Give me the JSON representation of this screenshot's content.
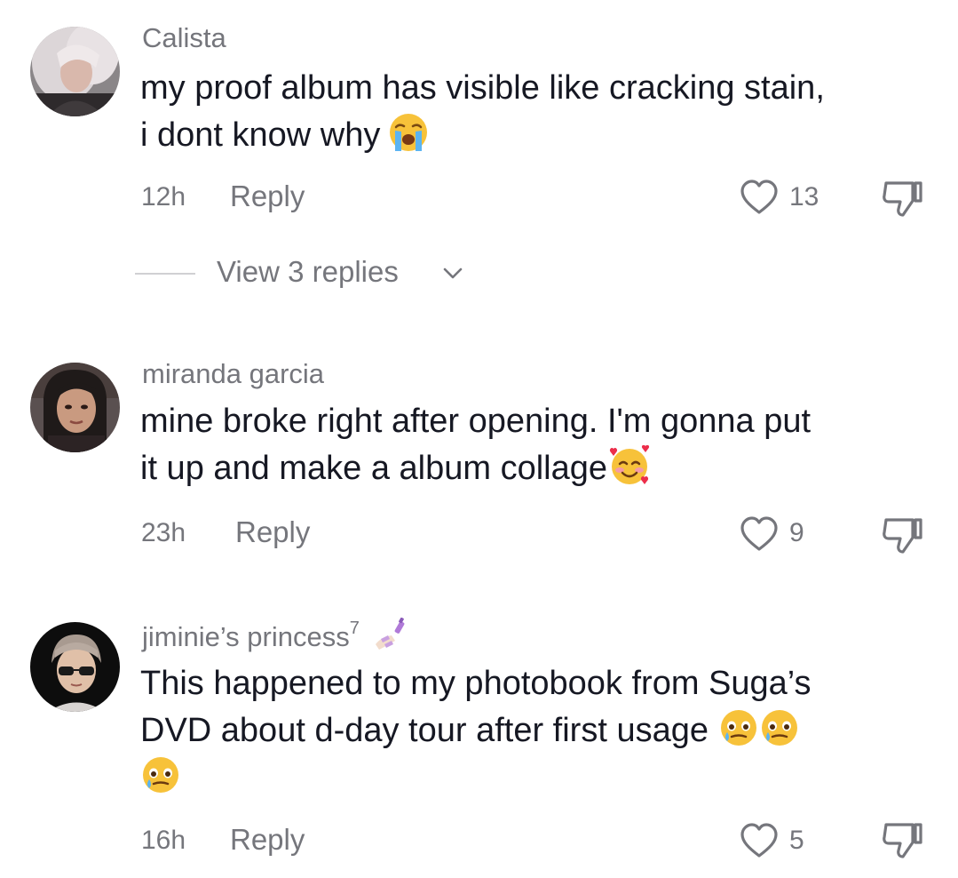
{
  "comments": [
    {
      "username": "Calista",
      "text_line1": "my proof album has visible like cracking stain,",
      "text_line2": "i dont know why ",
      "time": "12h",
      "reply_label": "Reply",
      "likes": "13",
      "emojis": [
        "loudly-crying-face-emoji"
      ],
      "view_replies": "View 3 replies"
    },
    {
      "username": "miranda garcia",
      "text_line1": "mine broke right after opening. I'm gonna put",
      "text_line2": "it up and make a album collage",
      "time": "23h",
      "reply_label": "Reply",
      "likes": "9",
      "emojis": [
        "smiling-face-with-hearts-emoji"
      ]
    },
    {
      "username": "jiminie’s princess",
      "username_sup": "7",
      "username_emoji": "nail-polish-emoji",
      "text_line1": "This happened to my photobook from Suga’s",
      "text_line2": "DVD about d-day tour after first usage ",
      "time": "16h",
      "reply_label": "Reply",
      "likes": "5",
      "emojis": [
        "face-holding-back-tears-emoji",
        "face-holding-back-tears-emoji",
        "face-holding-back-tears-emoji"
      ]
    }
  ],
  "colors": {
    "primary_text": "#161823",
    "secondary_text": "#75767c",
    "divider": "#d0d0d3",
    "background": "#ffffff"
  }
}
